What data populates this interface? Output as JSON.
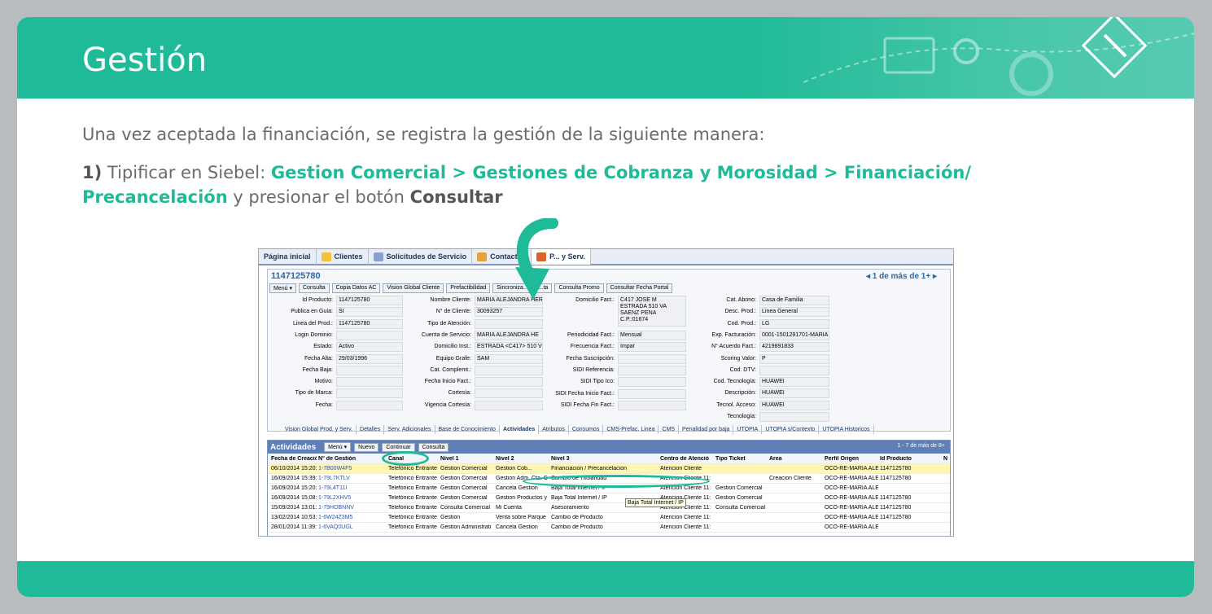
{
  "slide": {
    "title": "Gestión",
    "intro": "Una vez aceptada la financiación, se registra la gestión de la siguiente manera:",
    "step_number": "1)",
    "step_pre": " Tipificar en Siebel: ",
    "step_path": "Gestion Comercial > Gestiones de Cobranza y Morosidad > Financiación/ Precancelación",
    "step_mid": " y presionar el botón ",
    "step_button": "Consultar"
  },
  "colors": {
    "accent": "#1fba97",
    "siebel_header": "#5e7fb8"
  },
  "siebel": {
    "tabs": [
      "Página inicial",
      "Clientes",
      "Solicitudes de Servicio",
      "Contactos",
      "P... y Serv."
    ],
    "record_id": "1147125780",
    "pager": "1 de más de 1+",
    "buttons": [
      "Menú ▾",
      "Consulta",
      "Copia Datos AC",
      "Vision Global Cliente",
      "Prefactibilidad",
      "Sincroniza...",
      "...ta",
      "Consulta Promo",
      "Consultar Fecha Portal"
    ],
    "form": {
      "col1": [
        {
          "label": "Id Producto:",
          "value": "1147125780"
        },
        {
          "label": "Publica en Guía:",
          "value": "SI"
        },
        {
          "label": "Linea del Prod.:",
          "value": "1147125780"
        },
        {
          "label": "Login Dominio:",
          "value": ""
        },
        {
          "label": "Estado:",
          "value": "Activo"
        },
        {
          "label": "Fecha Alta:",
          "value": "29/03/1996"
        },
        {
          "label": "Fecha Baja:",
          "value": ""
        },
        {
          "label": "Motivo:",
          "value": ""
        },
        {
          "label": "Tipo de Marca:",
          "value": ""
        },
        {
          "label": "Fecha:",
          "value": ""
        }
      ],
      "col2": [
        {
          "label": "Nombre Cliente:",
          "value": "MARIA ALEJANDRA HERN"
        },
        {
          "label": "N° de Cliente:",
          "value": "30093257"
        },
        {
          "label": "Tipo de Atención:",
          "value": ""
        },
        {
          "label": "Cuenta de Servicio:",
          "value": "MARIA ALEJANDRA HE"
        },
        {
          "label": "Domicilio Inst.:",
          "value": "ESTRADA <C417> 510 VI"
        },
        {
          "label": "Equipo Grafe:",
          "value": "SAM"
        },
        {
          "label": "Cat. Complemt.:",
          "value": ""
        },
        {
          "label": "Fecha Inicio Fact.:",
          "value": ""
        },
        {
          "label": "Cortesía:",
          "value": ""
        },
        {
          "label": "Vigencia Cortesía:",
          "value": ""
        }
      ],
      "col3": [
        {
          "label": "Domicilio Fact.:",
          "value": "C417 JOSE M ESTRADA 510 VA SAENZ PENA C.P.:01674"
        },
        {
          "label": "Periodicidad Fact.:",
          "value": "Mensual"
        },
        {
          "label": "Frecuencia Fact.:",
          "value": "Impar"
        },
        {
          "label": "Fecha Suscripción:",
          "value": ""
        },
        {
          "label": "SIDI Referencia:",
          "value": ""
        },
        {
          "label": "SIDI Tipo Ico:",
          "value": ""
        },
        {
          "label": "SIDI Fecha Inicio Fact.:",
          "value": ""
        },
        {
          "label": "SIDI Fecha Fin Fact.:",
          "value": ""
        }
      ],
      "col4": [
        {
          "label": "Cat. Abono:",
          "value": "Casa de Familia"
        },
        {
          "label": "Desc. Prod.:",
          "value": "Linea General"
        },
        {
          "label": "Cod. Prod.:",
          "value": "LG"
        },
        {
          "label": "Exp. Facturación:",
          "value": "0001-1501291701-MARIA"
        },
        {
          "label": "N° Acuerdo Fact.:",
          "value": "4219891833"
        },
        {
          "label": "Scoring Valor:",
          "value": "P"
        },
        {
          "label": "Cod. DTV:",
          "value": ""
        },
        {
          "label": "Cod. Tecnología:",
          "value": "HUAWEI"
        },
        {
          "label": "Descripción:",
          "value": "HUAWEI"
        },
        {
          "label": "Tecnol. Acceso:",
          "value": "HUAWEI"
        },
        {
          "label": "Tecnología:",
          "value": ""
        }
      ]
    },
    "subtabs": [
      "Vision Global Prod. y Serv.",
      "Detalles",
      "Serv. Adicionales",
      "Base de Conocimiento",
      "Actividades",
      "Atributos",
      "Consumos",
      "CMS-Prefac. Linea",
      "CMS",
      "Penalidad por baja",
      "UTOPIA",
      "UTOPIA s/Contexto",
      "UTOPIA Historicos"
    ],
    "activities": {
      "title": "Actividades",
      "buttons": [
        "Menú ▾",
        "Nuevo",
        "Continuar",
        "Consulta"
      ],
      "pager": "1 - 7 de más de 8+",
      "columns": [
        "Fecha de Creació",
        "N° de Gestión",
        "Canal",
        "Nivel 1",
        "Nivel 2",
        "Nivel 3",
        "Centro de Atenció",
        "Tipo Ticket",
        "Área",
        "Perfil Origen",
        "Id Producto",
        "N"
      ],
      "rows": [
        [
          "06/10/2014 15:20:2",
          "1-7B00W4F5",
          "Telefónico Entrante",
          "Gestion Comercial",
          "Gestion Cob...",
          "Financiacion / Precancelacion",
          "Atencion Cliente",
          "",
          "",
          "OCO-RE-MARIA ALE",
          "1147125780"
        ],
        [
          "16/09/2014 15:39:4",
          "1-79L7KTLV",
          "Telefónico Entrante",
          "Gestion Comercial",
          "Gestion Adm. Cta. C",
          "Cambio de Titularidad",
          "Atencion Cliente 11:",
          "",
          "Creacion Cliente",
          "OCO-RE-MARIA ALE",
          "1147125780"
        ],
        [
          "16/09/2014 15:20:4",
          "1-79L4T11I",
          "Telefónico Entrante",
          "Gestion Comercial",
          "Cancela Gestion",
          "Baja Total Internet / IP",
          "Atencion Cliente 11:",
          "Gestion Comercial",
          "",
          "OCO-RE-MARIA ALE",
          ""
        ],
        [
          "16/09/2014 15:08:0",
          "1-79L2XHV5",
          "Telefónico Entrante",
          "Gestion Comercial",
          "Gestion Productos y",
          "Baja Total Internet / IP",
          "Atencion Cliente 11:",
          "Gestion Comercial",
          "",
          "OCO-RE-MARIA ALE",
          "1147125780"
        ],
        [
          "15/09/2014 13:01:0",
          "1-79HOBNNV",
          "Telefónico Entrante",
          "Consulta Comercial",
          "Mi Cuenta",
          "Asesoramiento",
          "Atencion Cliente 11:",
          "Consulta Comercial",
          "",
          "OCO-RE-MARIA ALE",
          "1147125780"
        ],
        [
          "13/02/2014 10:53:4",
          "1-6W24Z3M5",
          "Telefónico Entrante",
          "Gestion",
          "Venta sobre Parque",
          "Cambio de Producto",
          "Atencion Cliente 11:",
          "",
          "",
          "OCO-RE-MARIA ALE",
          "1147125780"
        ],
        [
          "28/01/2014 11:39:1",
          "1-6VAQ0UGL",
          "Telefónico Entrante",
          "Gestion Administrati",
          "Cancela Gestion",
          "Cambio de Producto",
          "Atencion Cliente 11:",
          "",
          "",
          "OCO-RE-MARIA ALE",
          ""
        ]
      ],
      "tooltip": "Baja Total Internet / IP"
    }
  }
}
